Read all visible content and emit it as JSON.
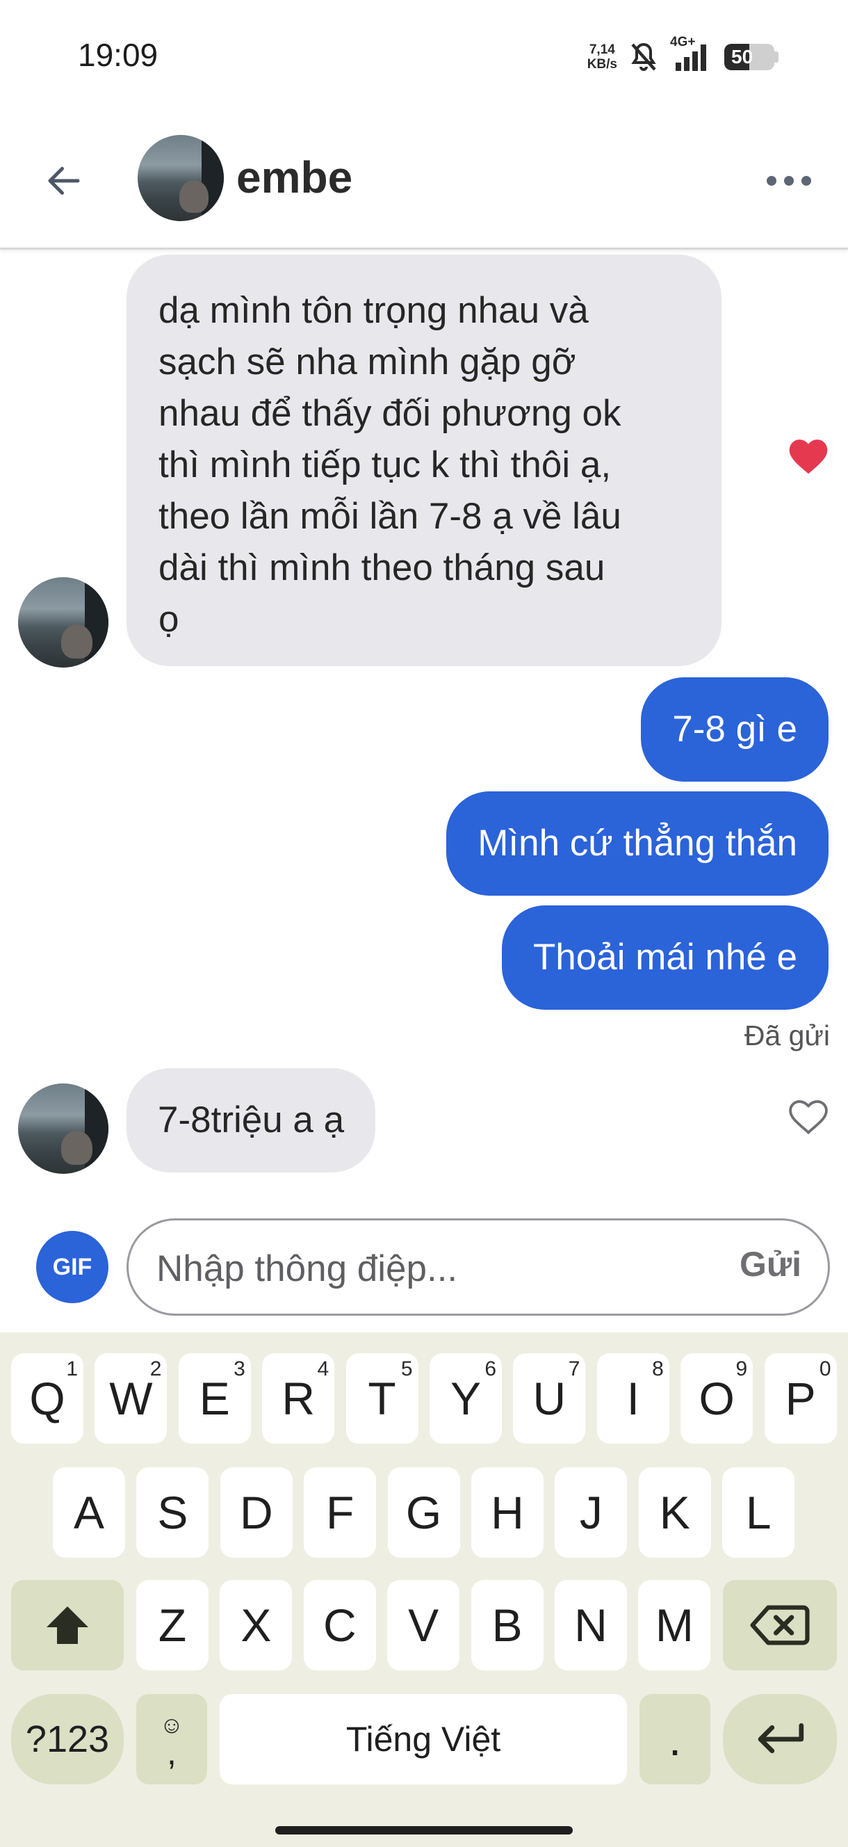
{
  "status_bar": {
    "time": "19:09",
    "net_speed_value": "7,14",
    "net_speed_unit": "KB/s",
    "network": "4G+",
    "battery": "50",
    "battery_level_percent": 50
  },
  "header": {
    "contact_name": "embe"
  },
  "messages": [
    {
      "direction": "incoming",
      "lines": [
        "dạ mình tôn trọng nhau và",
        "sạch sẽ nha mình gặp gỡ",
        "nhau để thấy đối phương ok",
        "thì mình tiếp tục k thì thôi ạ,",
        "theo lần mỗi lần 7-8 ạ về lâu",
        "dài thì mình theo tháng sau",
        "ọ"
      ],
      "liked": true
    },
    {
      "direction": "outgoing",
      "text": "7-8 gì e"
    },
    {
      "direction": "outgoing",
      "text": "Mình cứ thẳng thắn"
    },
    {
      "direction": "outgoing",
      "text": "Thoải mái nhé e"
    },
    {
      "direction": "incoming",
      "text": "7-8triệu a ạ",
      "liked": false
    }
  ],
  "sent_status": "Đã gửi",
  "composer": {
    "gif_label": "GIF",
    "placeholder": "Nhập thông điệp...",
    "send_label": "Gửi"
  },
  "keyboard": {
    "row1": [
      {
        "k": "Q",
        "h": "1"
      },
      {
        "k": "W",
        "h": "2"
      },
      {
        "k": "E",
        "h": "3"
      },
      {
        "k": "R",
        "h": "4"
      },
      {
        "k": "T",
        "h": "5"
      },
      {
        "k": "Y",
        "h": "6"
      },
      {
        "k": "U",
        "h": "7"
      },
      {
        "k": "I",
        "h": "8"
      },
      {
        "k": "O",
        "h": "9"
      },
      {
        "k": "P",
        "h": "0"
      }
    ],
    "row2": [
      "A",
      "S",
      "D",
      "F",
      "G",
      "H",
      "J",
      "K",
      "L"
    ],
    "row3": [
      "Z",
      "X",
      "C",
      "V",
      "B",
      "N",
      "M"
    ],
    "symbols_label": "?123",
    "comma_label": ",",
    "space_label": "Tiếng Việt",
    "period_label": "."
  },
  "colors": {
    "accent": "#2b63d9",
    "incoming_bubble": "#e8e8ec",
    "heart": "#e53950",
    "keyboard_bg": "#eeefe2"
  }
}
